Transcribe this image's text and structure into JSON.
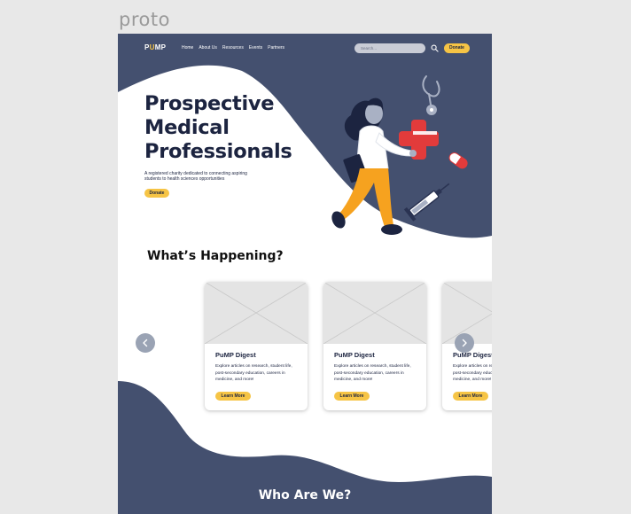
{
  "canvas_label": "proto",
  "colors": {
    "navy": "#44506f",
    "dark_text": "#1c2440",
    "accent": "#f6c445",
    "red": "#e23b3b"
  },
  "nav": {
    "logo": {
      "prefix": "P",
      "highlight": "U",
      "suffix": "MP"
    },
    "links": [
      "Home",
      "About Us",
      "Resources",
      "Events",
      "Partners"
    ],
    "search_placeholder": "Search...",
    "search_icon": "search-icon",
    "donate_label": "Donate"
  },
  "hero": {
    "title": "Prospective Medical Professionals",
    "subtitle": "A registered charity dedicated to connecting aspiring students to health sciences opportunities",
    "donate_label": "Donate"
  },
  "happening": {
    "title": "What’s Happening?",
    "prev_icon": "chevron-left-icon",
    "next_icon": "chevron-right-icon",
    "cards": [
      {
        "title": "PuMP Digest",
        "desc": "Explore articles on research, student life, post-secondary education, careers in medicine, and more!",
        "button": "Learn More"
      },
      {
        "title": "PuMP Digest",
        "desc": "Explore articles on research, student life, post-secondary education, careers in medicine, and more!",
        "button": "Learn More"
      },
      {
        "title": "PuMP Digest",
        "desc": "Explore articles on research, student life, post-secondary education, careers in medicine, and more!",
        "button": "Learn More"
      }
    ]
  },
  "who": {
    "title": "Who Are We?"
  }
}
